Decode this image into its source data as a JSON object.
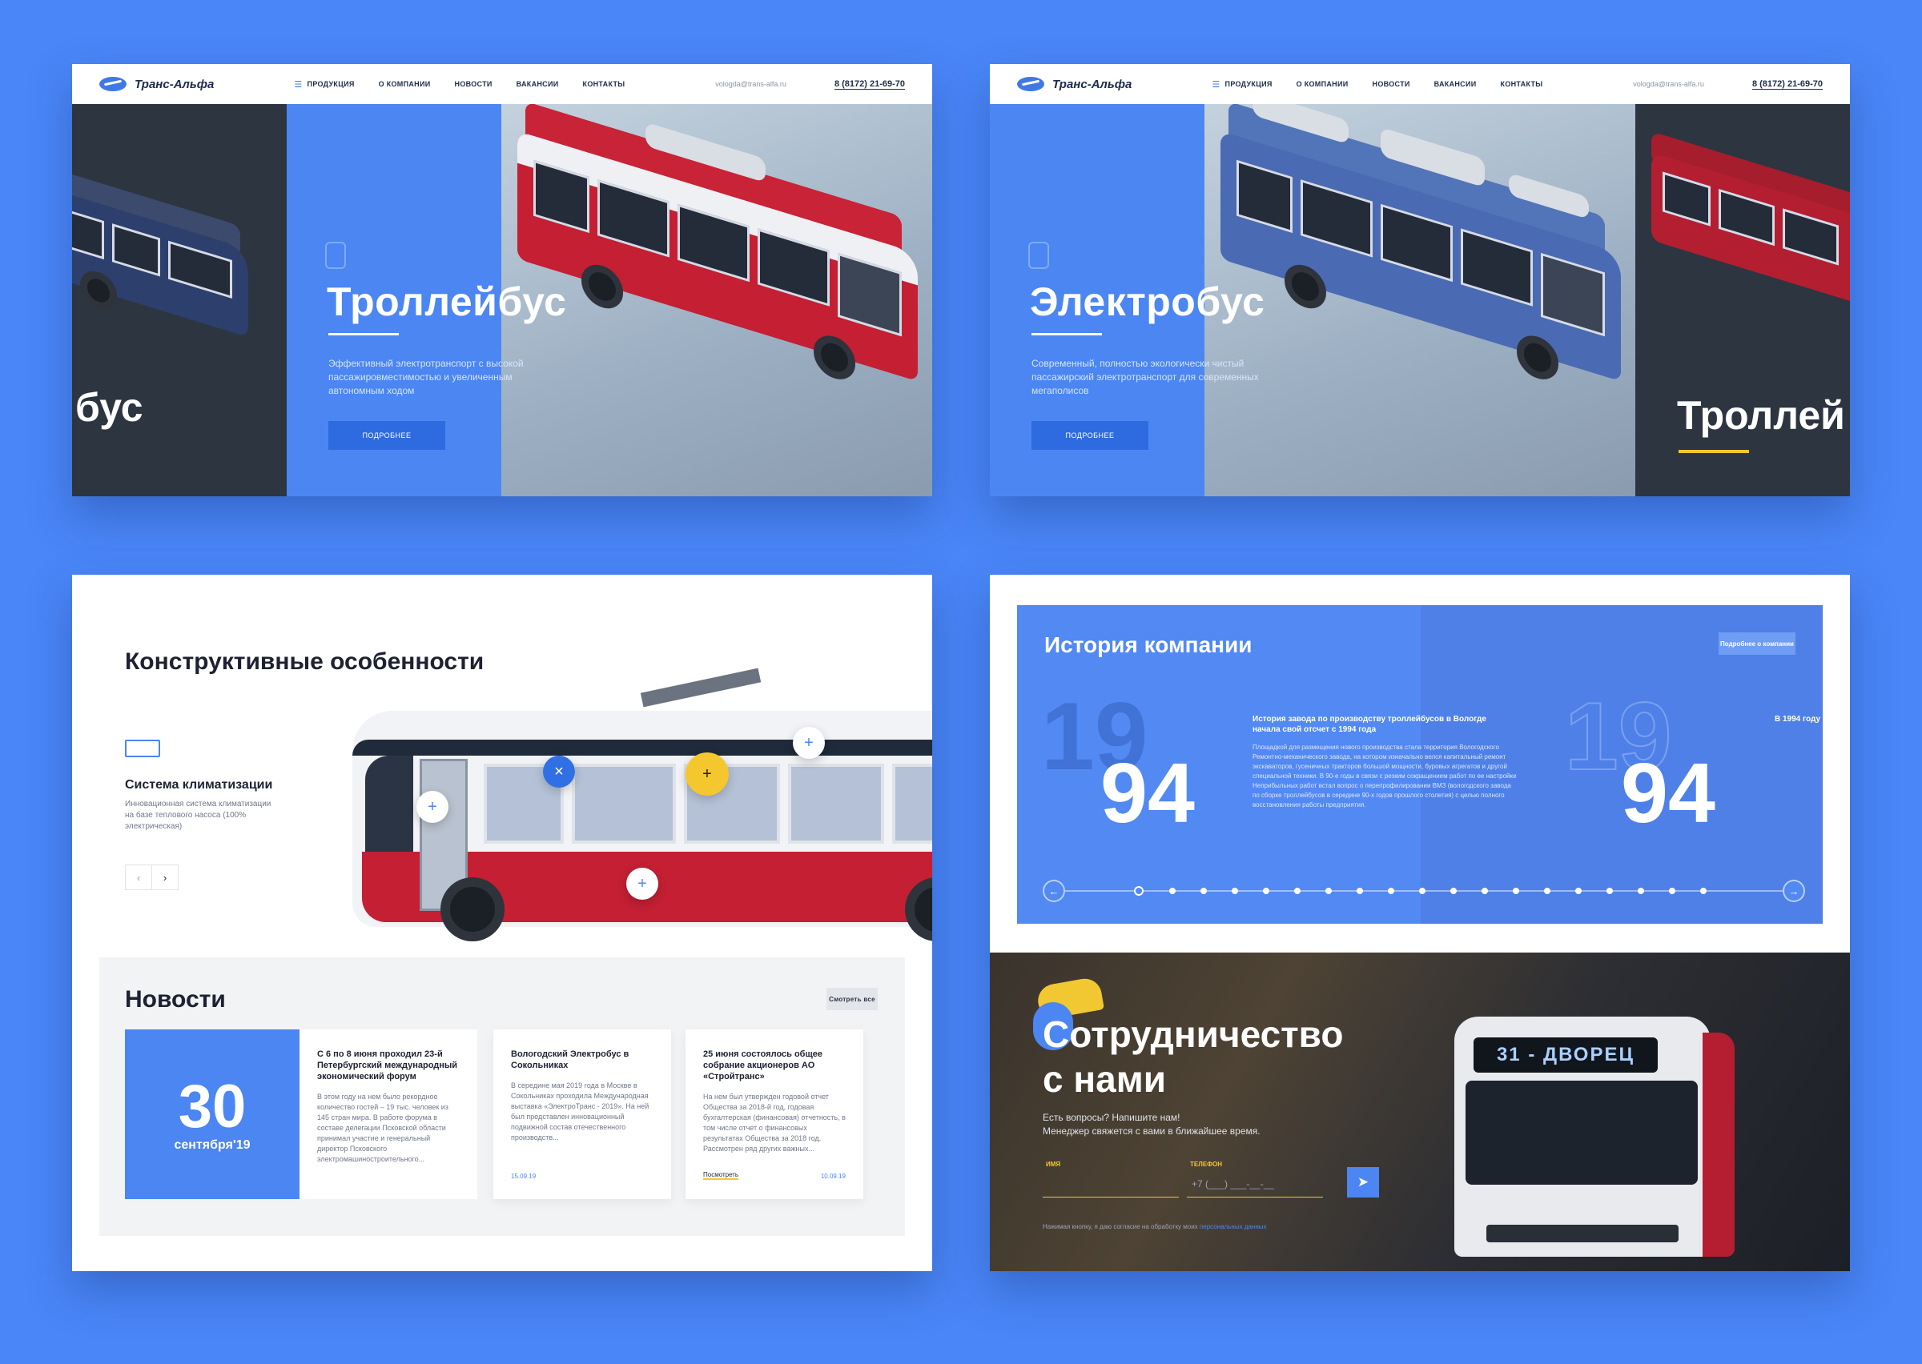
{
  "site": {
    "logo_text": "Транс-Альфа",
    "nav": [
      "Продукция",
      "О компании",
      "Новости",
      "Вакансии",
      "Контакты"
    ],
    "email": "vologda@trans-alfa.ru",
    "phone": "8 (8172) 21-69-70"
  },
  "hero1": {
    "title": "Троллейбус",
    "description": "Эффективный электротранспорт с высокой пассажировместимостью и увеличенным автономным ходом",
    "button": "Подробнее",
    "side_word": "бус"
  },
  "hero2": {
    "title": "Электробус",
    "description": "Современный, полностью экологически чистый пассажирский электротранспорт для современных мегаполисов",
    "button": "Подробнее",
    "side_word": "Троллей"
  },
  "features": {
    "title": "Конструктивные особенности",
    "item_title": "Система климатизации",
    "item_desc": "Инновационная система климатизации на базе теплового насоса (100% электрическая)",
    "prev": "‹",
    "next": "›",
    "hotspot_plus": "+",
    "hotspot_close": "×"
  },
  "news": {
    "title": "Новости",
    "see_all": "Смотреть все",
    "date_day": "30",
    "date_month": "сентября'19",
    "cards": [
      {
        "title": "С 6 по 8 июня проходил 23-й Петербургский международный экономический форум",
        "text": "В этом году на нем было рекордное количество гостей – 19 тыс. человек из 145 стран мира. В работе форума в составе делегации Псковской области принимал участие и генеральный директор Псковского электромашиностроительного..."
      },
      {
        "title": "Вологодский Электробус в Сокольниках",
        "text": "В середине мая 2019 года в Москве в Сокольниках проходила Международная выставка «ЭлектроТранс - 2019». На ней был представлен инновационный подвижной состав отечественного производств...",
        "date": "15.09.19"
      },
      {
        "title": "25 июня состоялось общее собрание акционеров АО «Стройтранс»",
        "text": "На нем был утвержден годовой отчет Общества за 2018-й год, годовая бухгалтерская (финансовая) отчетность, в том числе отчет о финансовых результатах Общества за 2018 год. Рассмотрен ряд других важных...",
        "more": "Посмотреть",
        "date": "10.09.19"
      }
    ]
  },
  "history": {
    "title": "История компании",
    "button": "Подробнее о компании",
    "year_top": "19",
    "year_bottom": "94",
    "heading": "История завода по производству троллейбусов в Вологде начала свой отсчет с 1994 года",
    "text": "Площадкой для размещения нового производства стала территория Вологодского Ремонтно-механического завода, на котором изначально велся капитальный ремонт экскаваторов, гусеничных тракторов большой мощности, буровых агрегатов и другой специальной техники. В 90-е годы в связи с резким сокращением работ по ее настройке Неприбыльных работ встал вопрос о перепрофилировании ВМЗ (вологодского завода по сборке троллейбусов в середине 90-х годов прошлого столетия) с целью полного восстановления работы предприятия.",
    "next_year": "В 1994 году",
    "prev_arrow": "←",
    "next_arrow": "→"
  },
  "cooperation": {
    "title_line1": "Сотрудничество",
    "title_line2": "с нами",
    "subtitle_line1": "Есть вопросы? Напишите нам!",
    "subtitle_line2": "Менеджер свяжется с вами в ближайшее время.",
    "name_label": "Имя",
    "phone_label": "Телефон",
    "phone_placeholder": "+7 (___) ___-__-__",
    "send_icon": "➤",
    "consent_text": "Нажимая кнопку, я даю согласие на обработку моих",
    "consent_link": "персональных данных",
    "bus_route": "31 - ДВОРЕЦ"
  }
}
